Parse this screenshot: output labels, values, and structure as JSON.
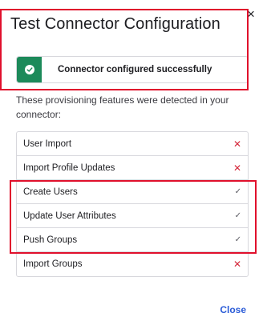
{
  "dialog": {
    "title": "Test Connector Configuration",
    "close_icon": "×",
    "banner": {
      "status": "success",
      "icon": "check-circle-icon",
      "text": "Connector configured successfully",
      "color": "#1c8a5a"
    },
    "description": "These provisioning features were detected in your connector:",
    "features": [
      {
        "label": "User Import",
        "detected": false,
        "mark": "✕"
      },
      {
        "label": "Import Profile Updates",
        "detected": false,
        "mark": "✕"
      },
      {
        "label": "Create Users",
        "detected": true,
        "mark": "✓"
      },
      {
        "label": "Update User Attributes",
        "detected": true,
        "mark": "✓"
      },
      {
        "label": "Push Groups",
        "detected": true,
        "mark": "✓"
      },
      {
        "label": "Import Groups",
        "detected": false,
        "mark": "✕"
      }
    ],
    "footer": {
      "close_label": "Close"
    }
  },
  "colors": {
    "highlight": "#e0102c",
    "missing": "#d5283b",
    "link": "#2a5bd7"
  }
}
